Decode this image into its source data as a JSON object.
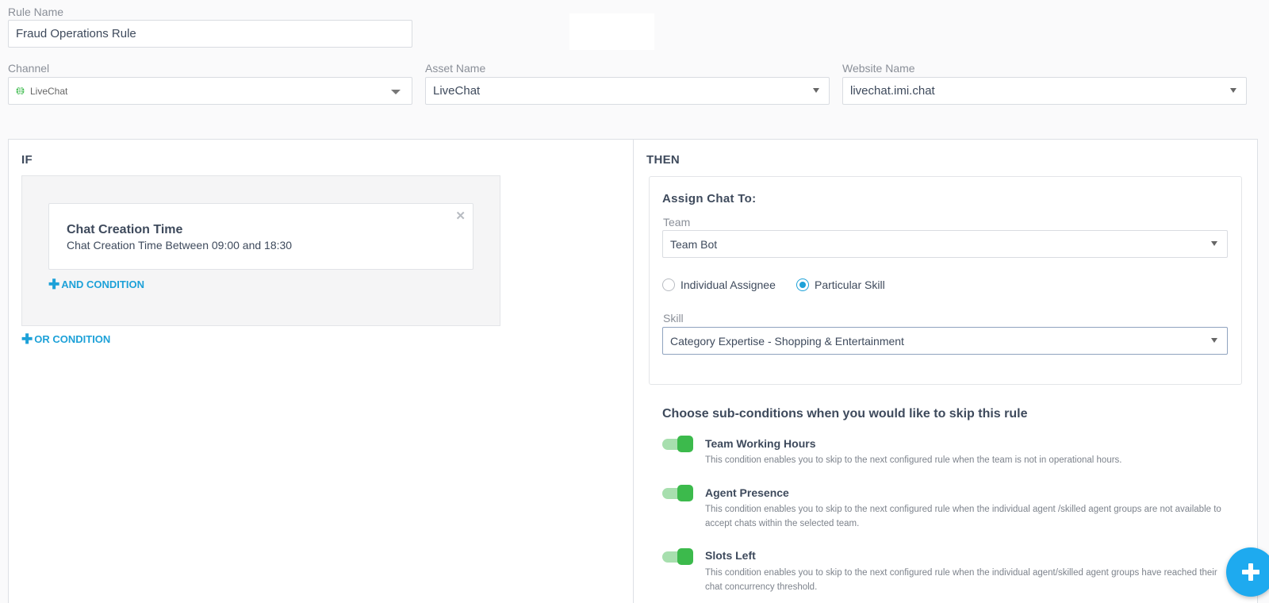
{
  "rule": {
    "name_label": "Rule Name",
    "name_value": "Fraud Operations Rule"
  },
  "channel": {
    "label": "Channel",
    "value": "LiveChat",
    "icon": "globe-icon"
  },
  "asset": {
    "label": "Asset Name",
    "value": "LiveChat"
  },
  "website": {
    "label": "Website Name",
    "value": "livechat.imi.chat"
  },
  "if_section": {
    "title": "IF",
    "conditions": [
      {
        "title": "Chat Creation Time",
        "description": "Chat Creation Time Between 09:00 and 18:30"
      }
    ],
    "and_label": "AND CONDITION",
    "or_label": "OR CONDITION"
  },
  "then_section": {
    "title": "THEN",
    "assign_title": "Assign Chat To:",
    "team_label": "Team",
    "team_value": "Team Bot",
    "radio_individual": "Individual Assignee",
    "radio_skill": "Particular Skill",
    "selected_radio": "Particular Skill",
    "skill_label": "Skill",
    "skill_value": "Category Expertise - Shopping & Entertainment"
  },
  "sub_conditions": {
    "heading": "Choose sub-conditions when you would like to skip this rule",
    "items": [
      {
        "title": "Team Working Hours",
        "description": "This condition enables you to skip to the next configured rule when the team is not in operational hours.",
        "enabled": true
      },
      {
        "title": "Agent Presence",
        "description": "This condition enables you to skip to the next configured rule when the individual agent /skilled agent groups are not available to accept chats within the selected team.",
        "enabled": true
      },
      {
        "title": "Slots Left",
        "description": "This condition enables you to skip to the next configured rule when the individual agent/skilled agent groups have reached their chat concurrency threshold.",
        "enabled": true
      }
    ]
  },
  "colors": {
    "accent": "#1da1d8",
    "toggle_on": "#3cba4c",
    "fab": "#1eaaef"
  }
}
